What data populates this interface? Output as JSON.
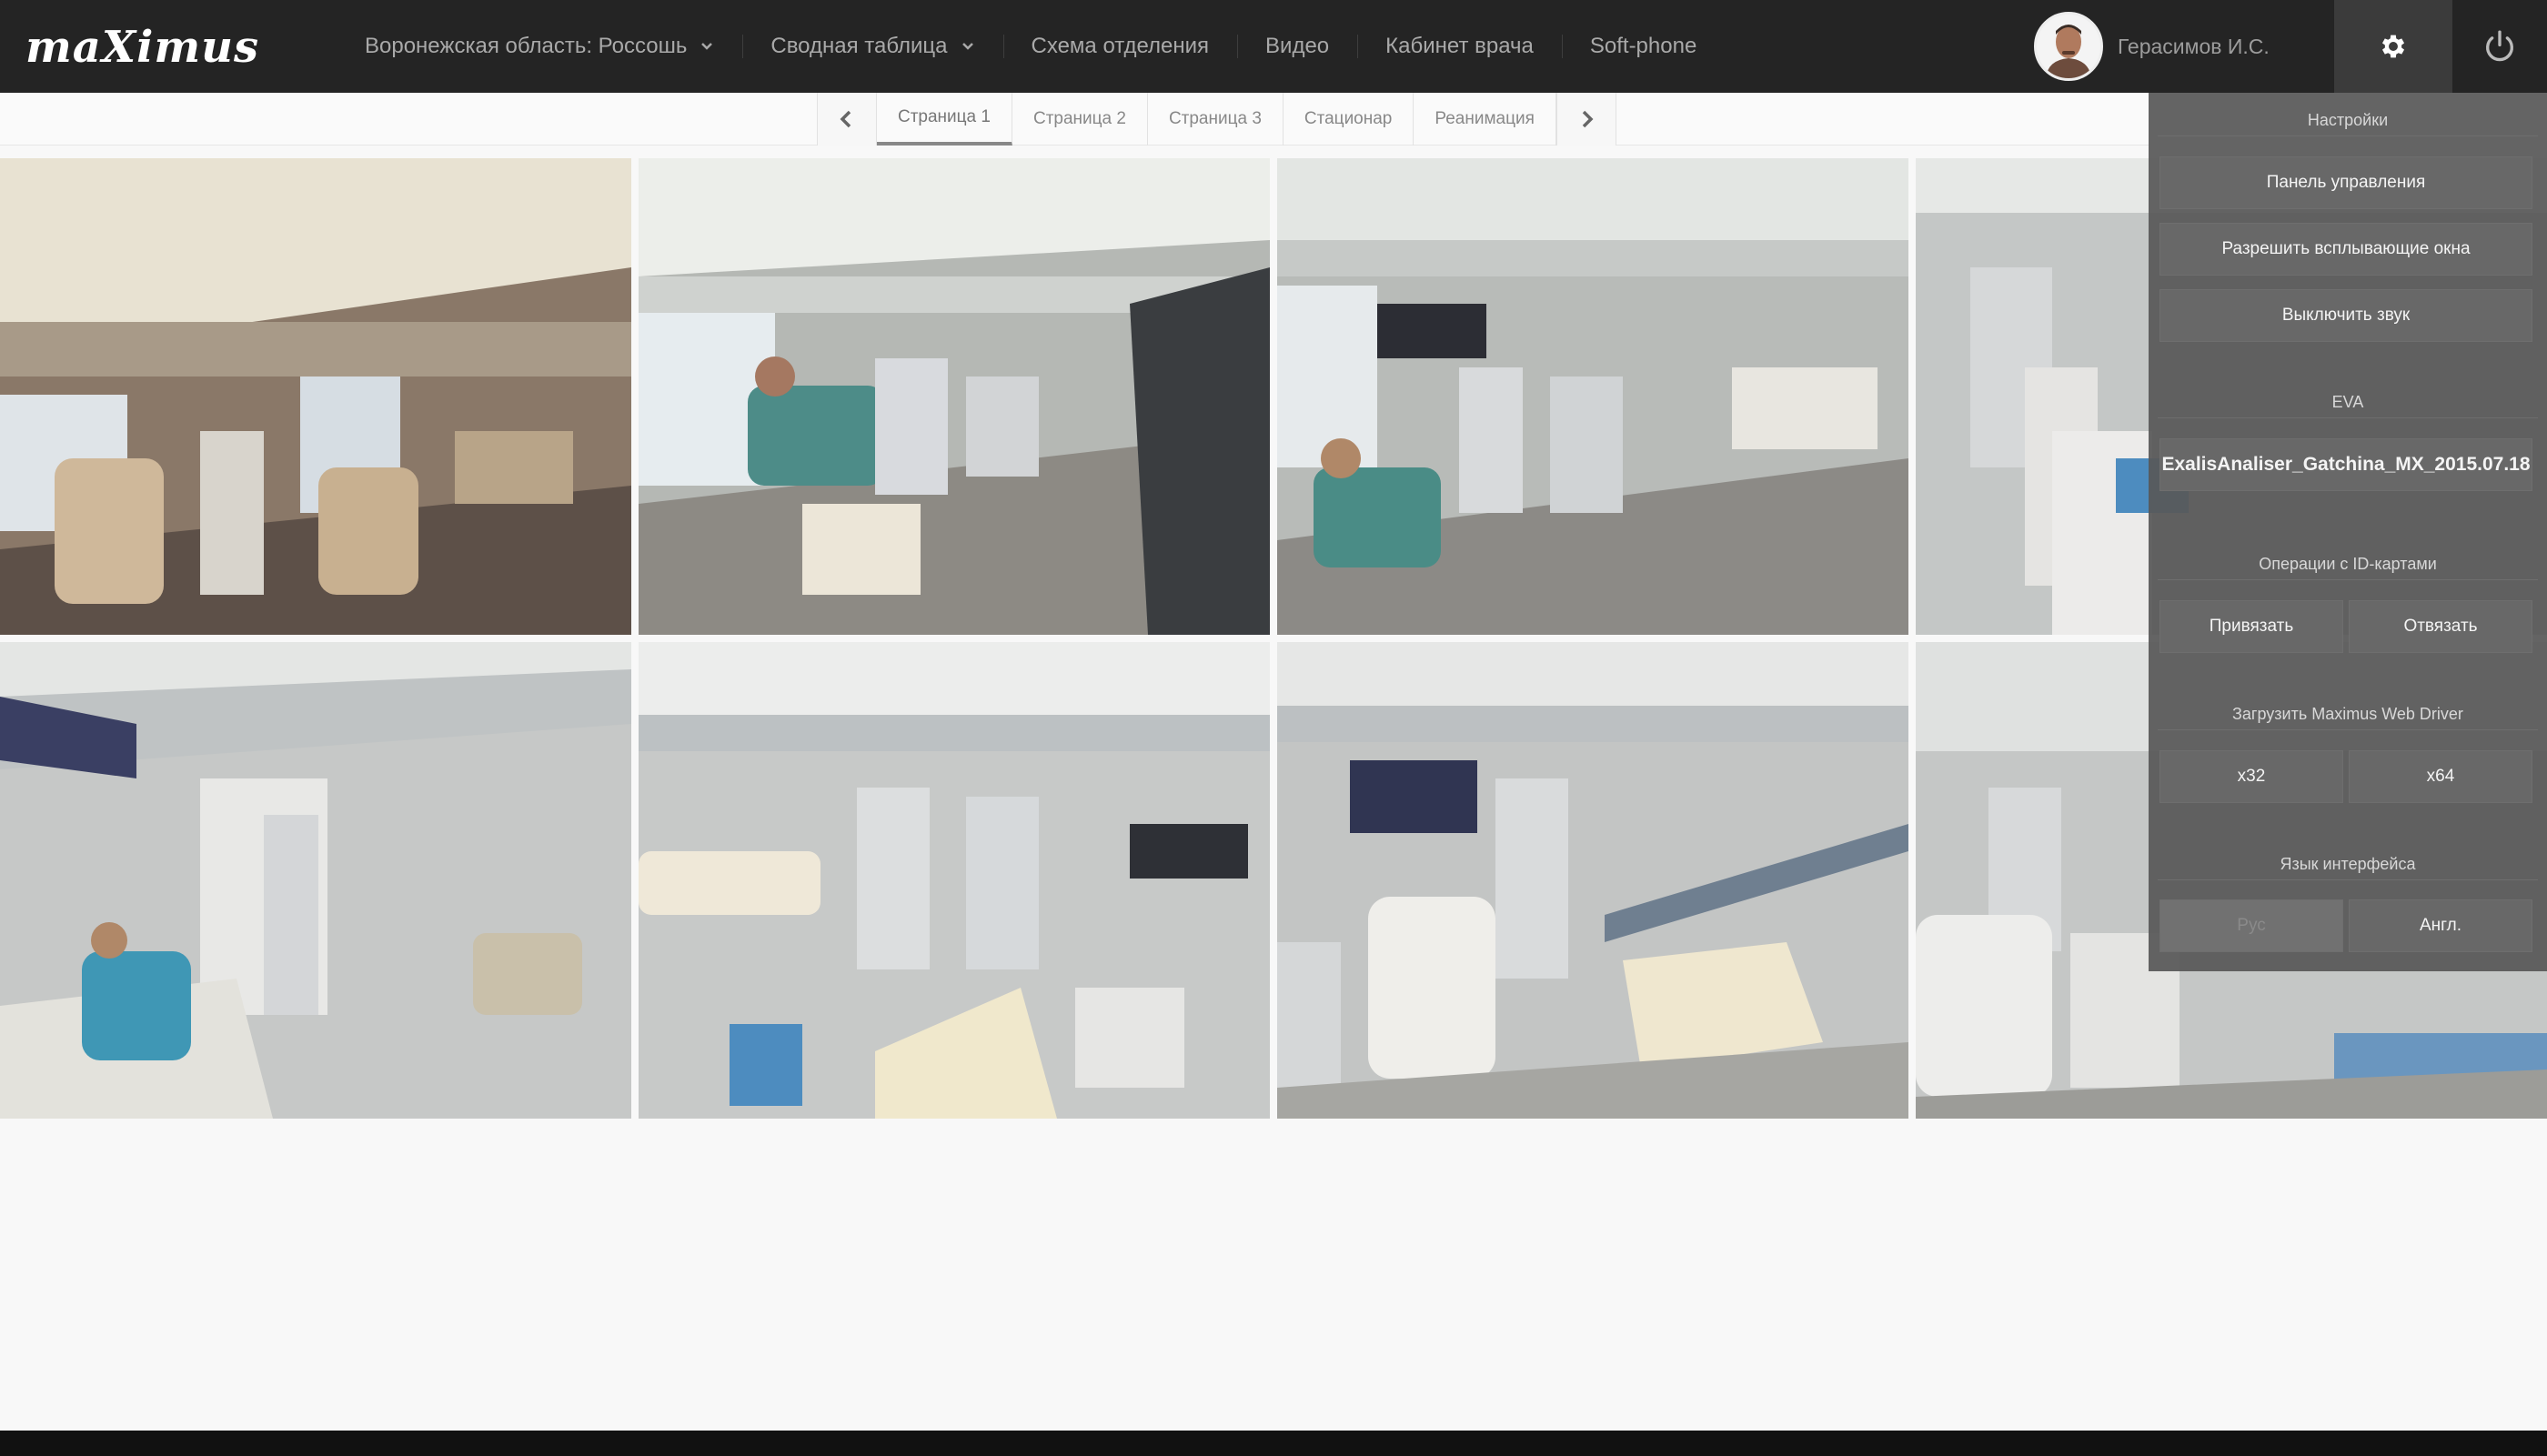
{
  "header": {
    "logo_text": "maXimus",
    "nav": [
      {
        "label": "Воронежская область: Россошь",
        "dropdown": true
      },
      {
        "label": "Сводная таблица",
        "dropdown": true
      },
      {
        "label": "Схема отделения",
        "dropdown": false
      },
      {
        "label": "Видео",
        "dropdown": false
      },
      {
        "label": "Кабинет врача",
        "dropdown": false
      },
      {
        "label": "Soft-phone",
        "dropdown": false
      }
    ],
    "user_name": "Герасимов И.С.",
    "settings_icon": "gear-icon",
    "power_icon": "power-icon"
  },
  "tabs": {
    "prev_icon": "chevron-left-icon",
    "next_icon": "chevron-right-icon",
    "items": [
      "Страница 1",
      "Страница 2",
      "Страница 3",
      "Стационар",
      "Реанимация"
    ],
    "active_index": 0
  },
  "cameras": [
    {
      "scene": "dialysis-ward-warm"
    },
    {
      "scene": "dialysis-ward-patient-green"
    },
    {
      "scene": "dialysis-ward-wide"
    },
    {
      "scene": "dialysis-bed-14-partial"
    },
    {
      "scene": "dialysis-bay-14"
    },
    {
      "scene": "dialysis-bay-15"
    },
    {
      "scene": "dialysis-bay-16"
    },
    {
      "scene": "dialysis-bay-19-20-partial"
    }
  ],
  "settings_panel": {
    "title": "Настройки",
    "buttons": [
      "Панель управления",
      "Разрешить всплывающие окна",
      "Выключить звук"
    ],
    "eva_title": "EVA",
    "eva_value": "ExalisAnaliser_Gatchina_MX_2015.07.18",
    "id_cards_title": "Операции с ID-картами",
    "id_cards_buttons": [
      "Привязать",
      "Отвязать"
    ],
    "driver_title": "Загрузить Maximus Web Driver",
    "driver_buttons": [
      "x32",
      "x64"
    ],
    "language_title": "Язык интерфейса",
    "language_buttons": [
      "Рус",
      "Англ."
    ],
    "language_disabled": "Рус"
  },
  "colors": {
    "topbar": "#242424",
    "accent_logo_x": "#e3262d",
    "panel": "#585858"
  }
}
